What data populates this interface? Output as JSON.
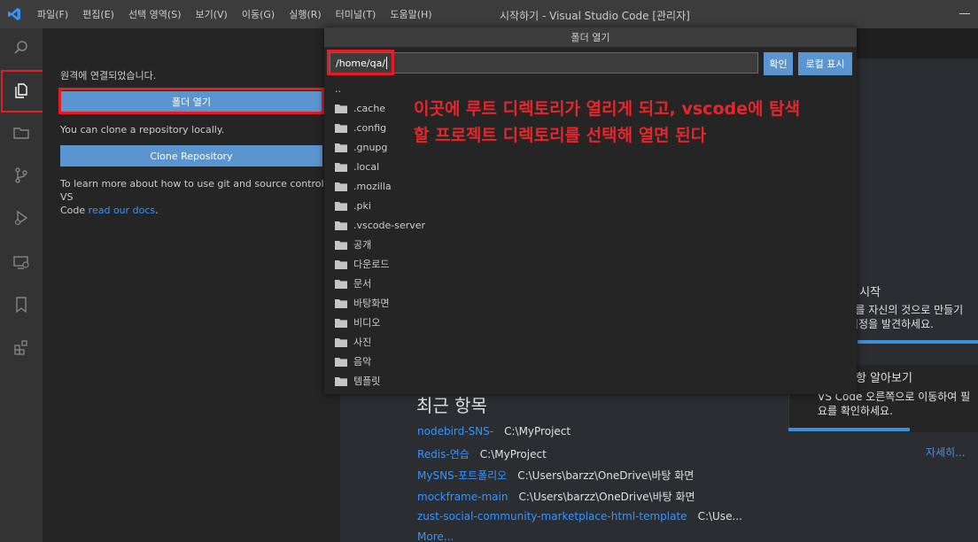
{
  "titlebar": {
    "menu": [
      "파일(F)",
      "편집(E)",
      "선택 영역(S)",
      "보기(V)",
      "이동(G)",
      "실행(R)",
      "터미널(T)",
      "도움말(H)"
    ],
    "title": "시작하기 - Visual Studio Code [관리자]"
  },
  "activitybar": {
    "icons": [
      "search-icon",
      "explorer-icon",
      "folder-icon",
      "source-control-icon",
      "run-debug-icon",
      "remote-explorer-icon",
      "bookmark-icon",
      "extensions-icon"
    ]
  },
  "sidebar": {
    "connected_text": "원격에 연결되었습니다.",
    "open_folder_label": "폴더 열기",
    "clone_hint": "You can clone a repository locally.",
    "clone_label": "Clone Repository",
    "learn_text_1": "To learn more about how to use git and source control in VS",
    "learn_text_2": "Code",
    "learn_link": "read our docs",
    "learn_end": "."
  },
  "dialog": {
    "title": "폴더 열기",
    "input_value": "/home/qa/",
    "confirm_label": "확인",
    "local_label": "로컬 표시",
    "items": [
      "..",
      ".cache",
      ".config",
      ".gnupg",
      ".local",
      ".mozilla",
      ".pki",
      ".vscode-server",
      "공개",
      "다운로드",
      "문서",
      "바탕화면",
      "비디오",
      "사진",
      "음악",
      "템플릿"
    ],
    "annotation_line1": "이곳에 루트 디렉토리가 열리게 되고, vscode에 탐색",
    "annotation_line2": "할 프로젝트 디렉토리를 선택해 열면 된다"
  },
  "walkthrough": {
    "start_title": "e 시작",
    "start_line1": "e를 자신의 것으로 만들기",
    "start_line2": "지정을 발견하세요.",
    "learn_title": "항 알아보기",
    "learn_line1": "VS Code 오른쪽으로 이동하여 필",
    "learn_line2": "요를 확인하세요.",
    "more_label": "자세히...",
    "progress_fraction": 0.64
  },
  "recent": {
    "title": "최근 항목",
    "items": [
      {
        "name": "nodebird-SNS-",
        "path": "C:\\MyProject"
      },
      {
        "name": "Redis-연습",
        "path": "C:\\MyProject"
      },
      {
        "name": "MySNS-포트폴리오",
        "path": "C:\\Users\\barzz\\OneDrive\\바탕 화면"
      },
      {
        "name": "mockframe-main",
        "path": "C:\\Users\\barzz\\OneDrive\\바탕 화면"
      },
      {
        "name": "zust-social-community-marketplace-html-template",
        "path": "C:\\Use..."
      }
    ],
    "more_label": "More..."
  },
  "colors": {
    "accent": "#3794ff",
    "button": "#5b95d0",
    "highlight": "#e51c23"
  }
}
